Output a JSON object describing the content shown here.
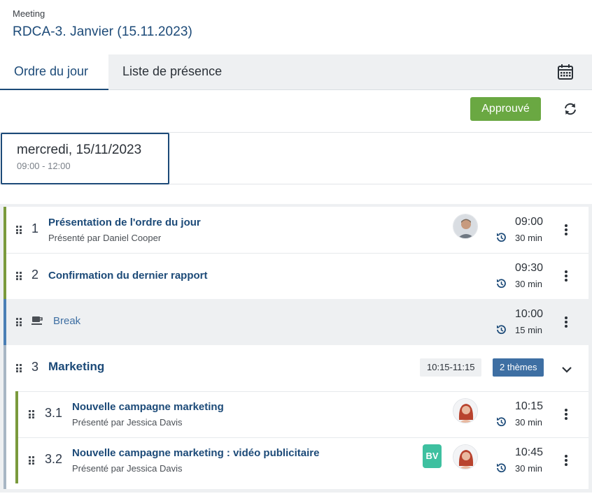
{
  "header": {
    "kicker": "Meeting",
    "title": "RDCA-3. Janvier (15.11.2023)"
  },
  "tabs": [
    {
      "label": "Ordre du jour",
      "active": true
    },
    {
      "label": "Liste de présence",
      "active": false
    }
  ],
  "toolbar": {
    "calendar_icon": "calendar-icon",
    "approve_label": "Approuvé",
    "refresh_icon": "refresh-icon"
  },
  "day": {
    "date": "mercredi, 15/11/2023",
    "hours": "09:00 - 12:00"
  },
  "colors": {
    "accent_blue": "#1c4a78",
    "approve_green": "#6aa842",
    "item_green": "#7a9a3c",
    "break_blue": "#4a7fb5",
    "themes_blue": "#3e6fa3",
    "bv_teal": "#3ec0a0"
  },
  "agenda": {
    "items": [
      {
        "num": "1",
        "title": "Présentation de l'ordre du jour",
        "presenter_prefix": "Présenté par",
        "presenter": "Daniel Cooper",
        "time": "09:00",
        "duration": "30 min"
      },
      {
        "num": "2",
        "title": "Confirmation du dernier rapport",
        "time": "09:30",
        "duration": "30 min"
      },
      {
        "title": "Break",
        "icon": "coffee-cup-icon",
        "time": "10:00",
        "duration": "15 min"
      },
      {
        "num": "3",
        "title": "Marketing",
        "time_range": "10:15-11:15",
        "themes": "2 thèmes"
      },
      {
        "num": "3.1",
        "title": "Nouvelle campagne marketing",
        "presenter_prefix": "Présenté par",
        "presenter": "Jessica Davis",
        "time": "10:15",
        "duration": "30 min"
      },
      {
        "num": "3.2",
        "title": "Nouvelle campagne marketing : vidéo publicitaire",
        "presenter_prefix": "Présenté par",
        "presenter": "Jessica Davis",
        "badge": "BV",
        "time": "10:45",
        "duration": "30 min"
      }
    ]
  }
}
